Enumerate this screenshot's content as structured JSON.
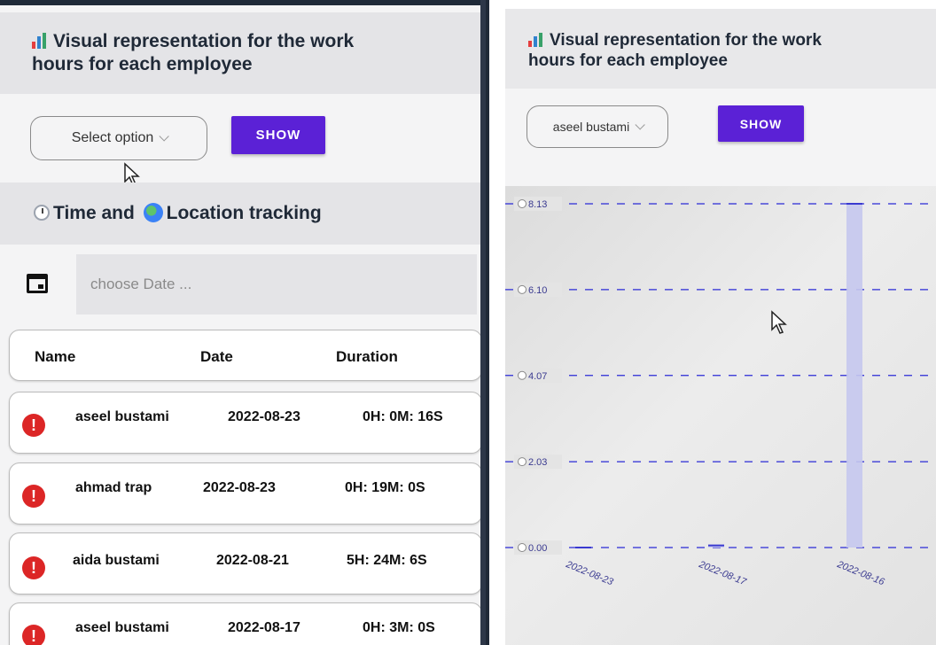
{
  "left": {
    "header": {
      "title_line1": "Visual representation for the work",
      "title_line2": "hours for each employee"
    },
    "select": {
      "value": "Select option"
    },
    "show_button": {
      "label": "SHOW"
    },
    "tracking": {
      "part1": "Time and",
      "part2": "Location tracking"
    },
    "date_input": {
      "placeholder": "choose Date ..."
    },
    "table": {
      "headers": {
        "name": "Name",
        "date": "Date",
        "duration": "Duration"
      },
      "rows": [
        {
          "name": "aseel bustami",
          "date": "2022-08-23",
          "duration": "0H: 0M: 16S"
        },
        {
          "name": "ahmad trap",
          "date": "2022-08-23",
          "duration": "0H: 19M: 0S"
        },
        {
          "name": "aida bustami",
          "date": "2022-08-21",
          "duration": "5H: 24M: 6S"
        },
        {
          "name": "aseel bustami",
          "date": "2022-08-17",
          "duration": "0H: 3M: 0S"
        }
      ]
    }
  },
  "right": {
    "header": {
      "title_line1": "Visual representation for the work",
      "title_line2": "hours for each employee"
    },
    "select": {
      "value": "aseel bustami"
    },
    "show_button": {
      "label": "SHOW"
    }
  },
  "chart_data": {
    "type": "bar",
    "title": "",
    "xlabel": "",
    "ylabel": "",
    "ylim": [
      0,
      8.13
    ],
    "yticks": [
      "8.13",
      "6.10",
      "4.07",
      "2.03",
      "0.00"
    ],
    "ytick_values": [
      8.13,
      6.1,
      4.07,
      2.03,
      0.0
    ],
    "categories": [
      "2022-08-23",
      "2022-08-17",
      "2022-08-16"
    ],
    "values": [
      0.0,
      0.05,
      8.13
    ],
    "grid": "dashed horizontal",
    "colors": {
      "bar": "#c5c8ee",
      "grid": "#2a2ad6",
      "cap": "#3a3ad0"
    }
  },
  "colors": {
    "accent": "#5b21d6",
    "error": "#dc2626"
  }
}
